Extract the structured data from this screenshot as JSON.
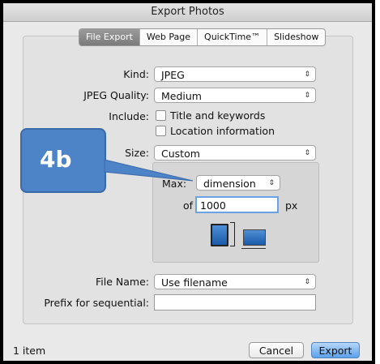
{
  "window": {
    "title": "Export Photos"
  },
  "tabs": [
    {
      "label": "File Export",
      "active": true
    },
    {
      "label": "Web Page",
      "active": false
    },
    {
      "label": "QuickTime™",
      "active": false
    },
    {
      "label": "Slideshow",
      "active": false
    }
  ],
  "kind": {
    "label": "Kind:",
    "value": "JPEG"
  },
  "quality": {
    "label": "JPEG Quality:",
    "value": "Medium"
  },
  "include": {
    "label": "Include:",
    "options": [
      {
        "label": "Title and keywords",
        "checked": false
      },
      {
        "label": "Location information",
        "checked": false
      }
    ]
  },
  "size": {
    "label": "Size:",
    "value": "Custom",
    "max_label": "Max:",
    "dimension_value": "dimension",
    "of_label": "of",
    "of_value": "1000",
    "unit": "px"
  },
  "file_name": {
    "label": "File Name:",
    "value": "Use filename"
  },
  "prefix": {
    "label": "Prefix for sequential:",
    "value": ""
  },
  "footer": {
    "count": "1 item",
    "cancel": "Cancel",
    "export": "Export"
  },
  "callout": {
    "text": "4b",
    "color": "#4d84c8"
  },
  "colors": {
    "accent": "#1f6fc4",
    "default_button": "#5aa0ec"
  }
}
